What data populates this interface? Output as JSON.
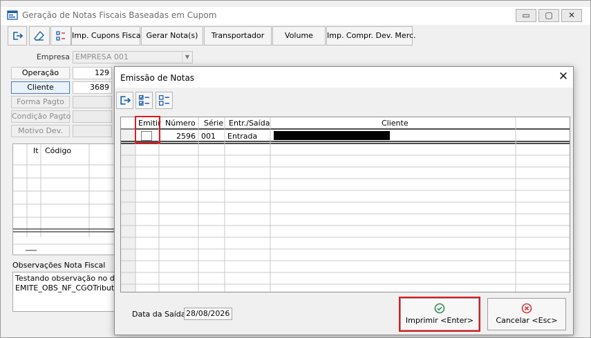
{
  "main": {
    "title": "Geração de Notas Fiscais Baseadas em Cupom",
    "window_buttons": {
      "minimize": "▭",
      "maximize": "▢",
      "close": "✕"
    },
    "toolbar": {
      "icons": [
        "exit-icon",
        "eraser-icon",
        "list-icon"
      ],
      "buttons": [
        "Imp. Cupons Fiscais",
        "Gerar Nota(s)",
        "Transportador",
        "Volume",
        "Imp. Compr. Dev. Merc."
      ]
    },
    "empresa_label": "Empresa",
    "empresa_value": "EMPRESA 001",
    "operacao_label": "Operação",
    "operacao_value": "129",
    "cliente_label": "Cliente",
    "cliente_value": "3689",
    "forma_pagto_label": "Forma Pagto",
    "condicao_pagto_label": "Condição Pagto",
    "motivo_dev_label": "Motivo Dev.",
    "items_columns": [
      "It",
      "Código"
    ],
    "obs_label": "Observações Nota Fiscal",
    "obs_lines": [
      "Testando observação no danfe",
      "EMITE_OBS_NF_CGOTribut. f"
    ]
  },
  "dialog": {
    "title": "Emissão de Notas",
    "close": "✕",
    "toolbar_icons": [
      "exit-icon",
      "check-all-icon",
      "uncheck-all-icon"
    ],
    "columns": [
      "Emitir",
      "Número",
      "Série",
      "Entr./Saída",
      "Cliente"
    ],
    "rows": [
      {
        "emitir": false,
        "numero": "2596",
        "serie": "001",
        "tipo": "Entrada",
        "cliente": ""
      }
    ],
    "data_saida_label": "Data da Saída",
    "data_saida_value": "28/08/2026",
    "imprimir_label": "Imprimir <Enter>",
    "cancelar_label": "Cancelar <Esc>"
  },
  "colors": {
    "highlight": "#e0181f",
    "ok_green": "#2e8b57",
    "cancel_red": "#d9363e",
    "accent_blue": "#1c5fa8"
  }
}
